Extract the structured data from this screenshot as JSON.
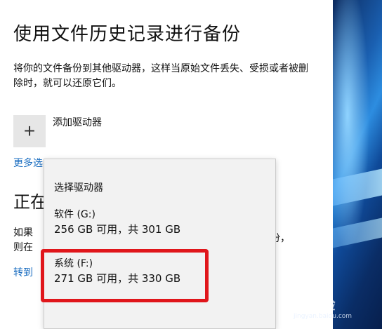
{
  "settings": {
    "title": "使用文件历史记录进行备份",
    "description": "将你的文件备份到其他驱动器，这样当原始文件丢失、受损或者被删除时，就可以还原它们。",
    "add_drive_label": "添加驱动器",
    "more_options_visible": "更多选",
    "section_heading_visible": "正在",
    "section_desc_line1_visible": "如果",
    "section_desc_line2_visible": "则在",
    "section_desc_tail_visible": "份，",
    "goto_link_visible": "转到"
  },
  "dropdown": {
    "title": "选择驱动器",
    "drives": [
      {
        "name": "软件 (G:)",
        "space": "256 GB 可用，共 301 GB"
      },
      {
        "name": "系统 (F:)",
        "space": "271 GB 可用，共 330 GB"
      }
    ]
  },
  "watermark": {
    "text": "Bai 经验",
    "sub": "jingyan.baidu.com"
  },
  "icons": {
    "add": "plus-icon"
  },
  "colors": {
    "link": "#1a6dc0",
    "highlight": "#e0161b"
  }
}
